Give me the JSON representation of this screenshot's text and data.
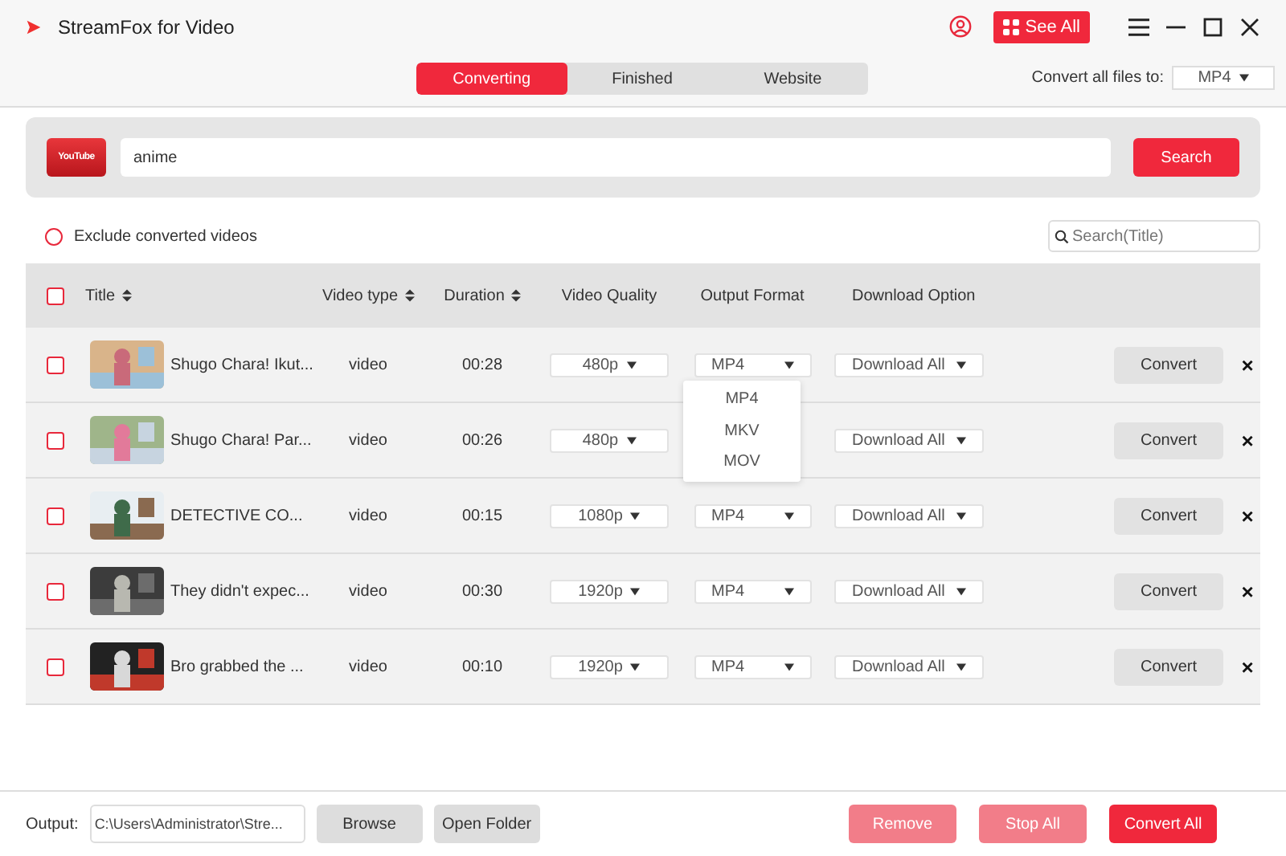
{
  "window": {
    "title": "StreamFox for Video",
    "see_all": "See All"
  },
  "tabs": [
    {
      "label": "Converting",
      "selected": true
    },
    {
      "label": "Finished",
      "selected": false
    },
    {
      "label": "Website",
      "selected": false
    }
  ],
  "convert_all": {
    "label": "Convert all files to:",
    "value": "MP4"
  },
  "search": {
    "source": "YouTube",
    "value": "anime",
    "button": "Search"
  },
  "exclude": {
    "label": "Exclude converted videos",
    "checked": false
  },
  "title_search": {
    "placeholder": "Search(Title)"
  },
  "table": {
    "all_checked": false,
    "columns": [
      "Title",
      "Video type",
      "Duration",
      "Video Quality",
      "Output Format",
      "Download Option"
    ],
    "rows": [
      {
        "checked": false,
        "title": "Shugo Chara! Ikut...",
        "type": "video",
        "duration": "00:28",
        "quality": "480p",
        "format": "MP4",
        "download": "Download All",
        "button": "Convert",
        "close": "×"
      },
      {
        "checked": false,
        "title": "Shugo Chara! Par...",
        "type": "video",
        "duration": "00:26",
        "quality": "480p",
        "download": "Download All",
        "button": "Convert",
        "close": "×"
      },
      {
        "checked": false,
        "title": "DETECTIVE CO...",
        "type": "video",
        "duration": "00:15",
        "quality": "1080p",
        "format": "MP4",
        "download": "Download All",
        "button": "Convert",
        "close": "×"
      },
      {
        "checked": false,
        "title": "They didn't expec...",
        "type": "video",
        "duration": "00:30",
        "quality": "1920p",
        "format": "MP4",
        "download": "Download All",
        "button": "Convert",
        "close": "×"
      },
      {
        "checked": false,
        "title": "Bro grabbed the ...",
        "type": "video",
        "duration": "00:10",
        "quality": "1920p",
        "format": "MP4",
        "download": "Download All",
        "button": "Convert",
        "close": "×"
      }
    ]
  },
  "format_menu": [
    "MP4",
    "MKV",
    "MOV"
  ],
  "footer": {
    "output_label": "Output:",
    "output_path": "C:\\Users\\Administrator\\Stre...",
    "buttons": [
      {
        "label": "Browse",
        "kind": "plain",
        "disabled": false
      },
      {
        "label": "Open Folder",
        "kind": "plain",
        "disabled": false
      },
      {
        "label": "Remove",
        "kind": "primary",
        "disabled": true
      },
      {
        "label": "Stop All",
        "kind": "primary",
        "disabled": true
      },
      {
        "label": "Convert All",
        "kind": "primary",
        "disabled": false
      }
    ]
  }
}
